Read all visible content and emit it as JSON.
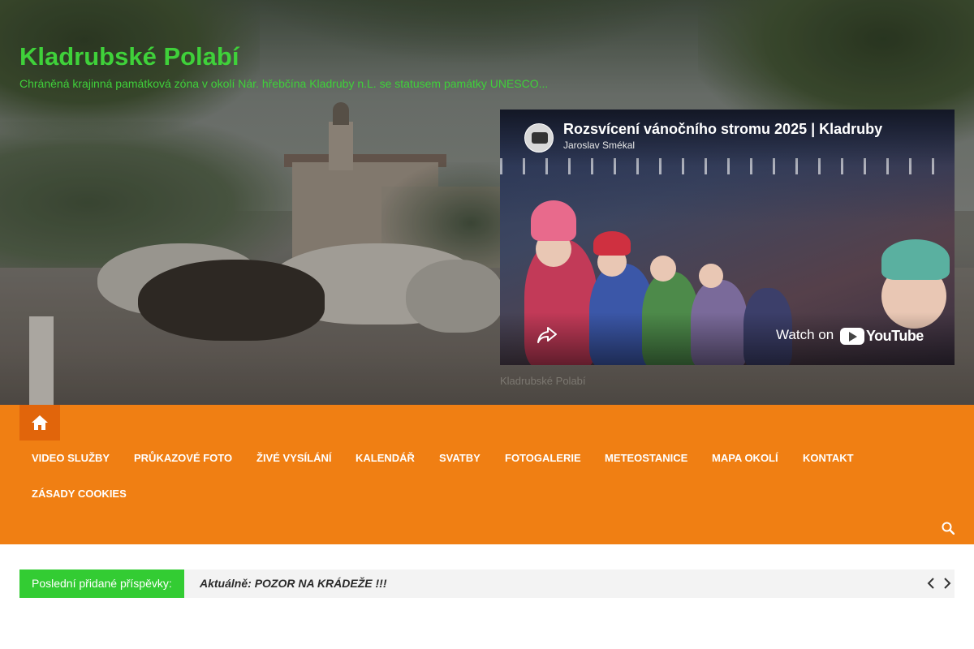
{
  "header": {
    "site_title": "Kladrubské Polabí",
    "site_description": "Chráněná krajinná památková zóna v okolí Nár. hřebčína Kladruby n.L. se statusem památky UNESCO..."
  },
  "video": {
    "title": "Rozsvícení vánočního stromu 2025 | Kladruby",
    "channel": "Jaroslav Smékal",
    "watch_label": "Watch on",
    "platform": "YouTube"
  },
  "hero": {
    "faint_caption": "Kladrubské Polabí"
  },
  "nav": {
    "home_icon": "home-icon",
    "items": [
      {
        "label": "Video služby"
      },
      {
        "label": "Průkazové foto"
      },
      {
        "label": "Živé vysílání"
      },
      {
        "label": "Kalendář"
      },
      {
        "label": "Svatby"
      },
      {
        "label": "Fotogalerie"
      },
      {
        "label": "Meteostanice"
      },
      {
        "label": "Mapa okolí"
      },
      {
        "label": "Kontakt"
      },
      {
        "label": "Zásady cookies"
      }
    ],
    "search_icon": "search-icon"
  },
  "ticker": {
    "label": "Poslední přidané příspěvky:",
    "prefix": "Aktuálně:",
    "headline": "POZOR NA KRÁDEŽE !!!"
  },
  "colors": {
    "accent_green": "#3fd13a",
    "nav_orange": "#f07f13",
    "home_orange": "#e1650b",
    "ticker_green": "#33cc33"
  }
}
